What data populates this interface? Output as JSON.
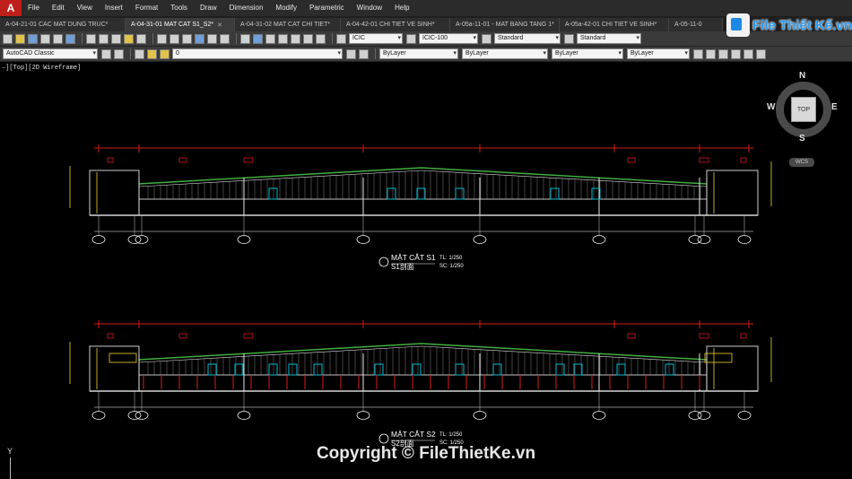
{
  "menubar": {
    "items": [
      "File",
      "Edit",
      "View",
      "Insert",
      "Format",
      "Tools",
      "Draw",
      "Dimension",
      "Modify",
      "Parametric",
      "Window",
      "Help"
    ]
  },
  "tabs": [
    {
      "label": "A-04-21-01 CAC MAT DUNG TRUC*",
      "active": false
    },
    {
      "label": "A-04-31-01 MAT CAT S1_S2*",
      "active": true
    },
    {
      "label": "A-04-31-02 MAT CAT CHI TIET*",
      "active": false
    },
    {
      "label": "A-04-42-01 CHI TIET VE SINH*",
      "active": false
    },
    {
      "label": "A-05a-11-01 - MAT BANG TANG 1*",
      "active": false
    },
    {
      "label": "A-05a-42-01 CHI TIET VE SINH*",
      "active": false
    },
    {
      "label": "A-05-11-0",
      "active": false
    }
  ],
  "toolbar1": {
    "text_style": "ICIC",
    "dim_style": "ICIC-100",
    "table_style": "Standard",
    "multileader_style": "Standard"
  },
  "toolbar2": {
    "workspace": "AutoCAD Classic",
    "layer": "0",
    "color": "ByLayer",
    "linetype": "ByLayer",
    "lineweight": "ByLayer",
    "plotstyle": "ByLayer"
  },
  "viewport": {
    "label": "–][Top][2D Wireframe]"
  },
  "viewcube": {
    "top": "TOP",
    "north": "N",
    "south": "S",
    "east": "E",
    "west": "W",
    "wcs": "WCS"
  },
  "brand": {
    "text": "File Thiết Kế.vn"
  },
  "sections": [
    {
      "title": "MẶT CẮT S1",
      "subtitle": "S1剖面",
      "tl": "TL: 1/250",
      "sc": "SC: 1/250"
    },
    {
      "title": "MẶT CẮT S2",
      "subtitle": "S2剖面",
      "tl": "TL: 1/250",
      "sc": "SC: 1/250"
    }
  ],
  "ucs": {
    "y": "Y"
  },
  "copyright": "Copyright © FileThietKe.vn",
  "colors": {
    "menubar": "#2b2b2b",
    "toolbar": "#3a3a3a",
    "canvas": "#000000",
    "roof": "#3fae3f",
    "dimension": "#d81b1b",
    "structure": "#ffffff",
    "accent_cyan": "#00bcd4",
    "accent_yellow": "#f2d230",
    "brand": "#2b9bf0"
  }
}
